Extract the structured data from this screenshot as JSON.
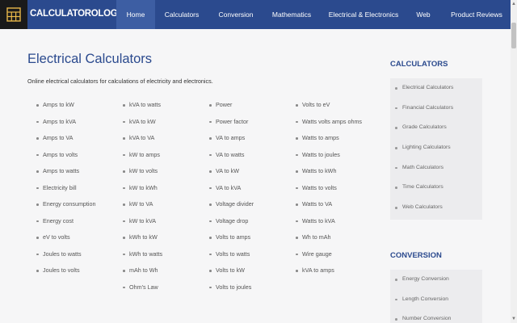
{
  "header": {
    "logo_text": "CALCULATOROLOGY",
    "nav": [
      {
        "label": "Home",
        "active": true
      },
      {
        "label": "Calculators"
      },
      {
        "label": "Conversion"
      },
      {
        "label": "Mathematics"
      },
      {
        "label": "Electrical & Electronics"
      },
      {
        "label": "Web"
      },
      {
        "label": "Product Reviews"
      }
    ]
  },
  "main": {
    "title": "Electrical Calculators",
    "intro": "Online electrical calculators for calculations of electricity and electronics.",
    "columns": [
      [
        "Amps to kW",
        "Amps to kVA",
        "Amps to VA",
        "Amps to volts",
        "Amps to watts",
        "Electricity bill",
        "Energy consumption",
        "Energy cost",
        "eV to volts",
        "Joules to watts",
        "Joules to volts"
      ],
      [
        "kVA to watts",
        "kVA to kW",
        "kVA to VA",
        "kW to amps",
        "kW to volts",
        "kW to kWh",
        "kW to VA",
        "kW to kVA",
        "kWh to kW",
        "kWh to watts",
        "mAh to Wh",
        "Ohm's Law"
      ],
      [
        "Power",
        "Power factor",
        "VA to amps",
        "VA to watts",
        "VA to kW",
        "VA to kVA",
        "Voltage divider",
        "Voltage drop",
        "Volts to amps",
        "Volts to watts",
        "Volts to kW",
        "Volts to joules"
      ],
      [
        "Volts to eV",
        "Watts volts amps ohms",
        "Watts to amps",
        "Watts to joules",
        "Watts to kWh",
        "Watts to volts",
        "Watts to VA",
        "Watts to kVA",
        "Wh to mAh",
        "Wire gauge",
        "kVA to amps"
      ]
    ]
  },
  "sidebar": {
    "calculators_heading": "CALCULATORS",
    "calculators": [
      "Electrical Calculators",
      "Financial Calculators",
      "Grade Calculators",
      "Lighting Calculators",
      "Math Calculators",
      "Time Calculators",
      "Web Calculators"
    ],
    "conversion_heading": "CONVERSION",
    "conversion": [
      "Energy Conversion",
      "Length Conversion",
      "Number Conversion"
    ]
  },
  "colors": {
    "nav_bg": "#2b4a8e",
    "accent": "#2b4a8e",
    "logo_bg": "#1a1a1a"
  }
}
